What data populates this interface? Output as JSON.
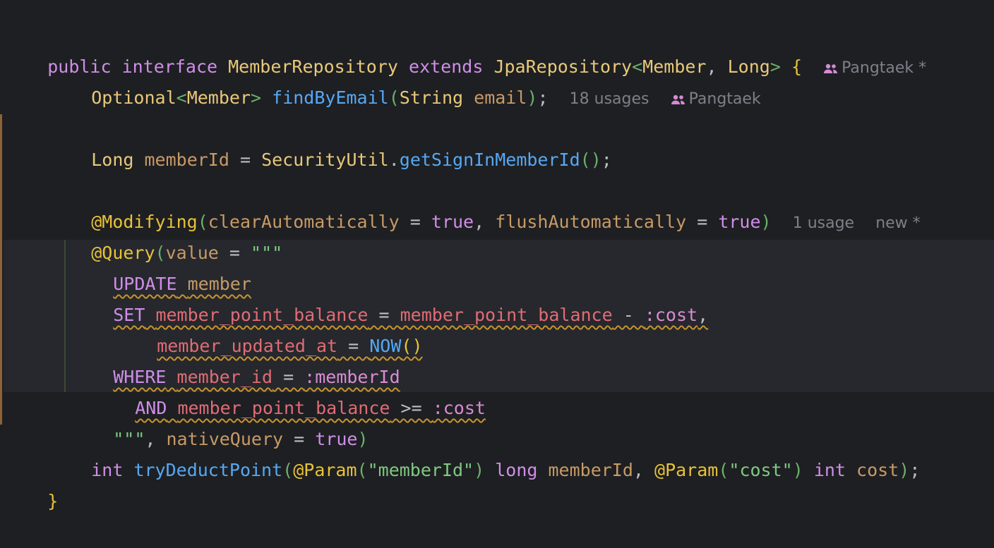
{
  "code": {
    "l1": {
      "public": "public",
      "interface": "interface",
      "name": "MemberRepository",
      "extends": "extends",
      "jpa": "JpaRepository",
      "lt": "<",
      "member": "Member",
      "comma": ", ",
      "long": "Long",
      "gt": ">",
      "brace": "{",
      "author": "Pangtaek *"
    },
    "l2": {
      "optional": "Optional",
      "lt": "<",
      "member": "Member",
      "gt": ">",
      "fn": "findByEmail",
      "lp": "(",
      "string": "String",
      "param": "email",
      "rp": ")",
      "semi": ";",
      "usages": "18 usages",
      "author": "Pangtaek"
    },
    "l3": {
      "long": "Long",
      "var": "memberId",
      "eq": " = ",
      "cls": "SecurityUtil",
      "dot": ".",
      "fn": "getSignInMemberId",
      "parens": "()",
      "semi": ";"
    },
    "l4": {
      "ann": "@Modifying",
      "lp": "(",
      "a1": "clearAutomatically",
      "eq": " = ",
      "t1": "true",
      "comma": ", ",
      "a2": "flushAutomatically",
      "t2": "true",
      "rp": ")",
      "usages": "1 usage",
      "author": "new *"
    },
    "l5": {
      "ann": "@Query",
      "lp": "(",
      "attr": "value",
      "eq": " = ",
      "str": "\"\"\""
    },
    "l6": {
      "kw": "UPDATE",
      "tbl": "member"
    },
    "l7": {
      "kw": "SET",
      "c1": "member_point_balance",
      "eq": " = ",
      "c2": "member_point_balance",
      "minus": " - ",
      "ph": ":cost",
      "comma": ","
    },
    "l8": {
      "c1": "member_updated_at",
      "eq": " = ",
      "fn": "NOW",
      "parens": "()"
    },
    "l9": {
      "kw": "WHERE",
      "c1": "member_id",
      "eq": " = ",
      "ph": ":memberId"
    },
    "l10": {
      "kw": "AND",
      "c1": "member_point_balance",
      "op": " >= ",
      "ph": ":cost"
    },
    "l11": {
      "str": "\"\"\"",
      "comma": ", ",
      "attr": "nativeQuery",
      "eq": " = ",
      "t": "true",
      "rp": ")"
    },
    "l12": {
      "int": "int",
      "fn": "tryDeductPoint",
      "lp": "(",
      "ann1": "@Param",
      "lp1": "(",
      "s1": "\"memberId\"",
      "rp1": ")",
      "long": " long ",
      "p1": "memberId",
      "comma": ", ",
      "ann2": "@Param",
      "lp2": "(",
      "s2": "\"cost\"",
      "rp2": ")",
      "int2": " int ",
      "p2": "cost",
      "rp": ")",
      "semi": ";"
    },
    "l13": {
      "brace": "}"
    }
  }
}
